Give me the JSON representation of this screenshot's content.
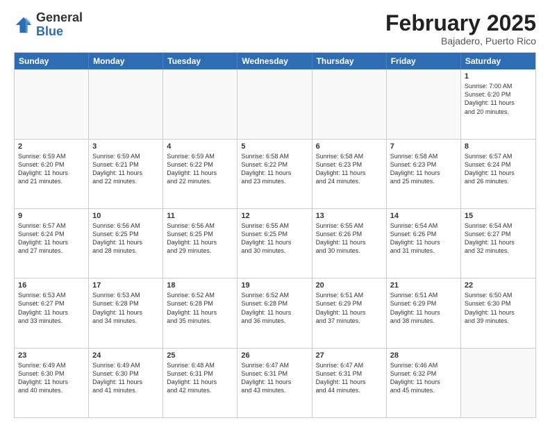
{
  "logo": {
    "general": "General",
    "blue": "Blue"
  },
  "header": {
    "month": "February 2025",
    "location": "Bajadero, Puerto Rico"
  },
  "days": [
    "Sunday",
    "Monday",
    "Tuesday",
    "Wednesday",
    "Thursday",
    "Friday",
    "Saturday"
  ],
  "weeks": [
    [
      {
        "day": "",
        "info": ""
      },
      {
        "day": "",
        "info": ""
      },
      {
        "day": "",
        "info": ""
      },
      {
        "day": "",
        "info": ""
      },
      {
        "day": "",
        "info": ""
      },
      {
        "day": "",
        "info": ""
      },
      {
        "day": "1",
        "info": "Sunrise: 7:00 AM\nSunset: 6:20 PM\nDaylight: 11 hours\nand 20 minutes."
      }
    ],
    [
      {
        "day": "2",
        "info": "Sunrise: 6:59 AM\nSunset: 6:20 PM\nDaylight: 11 hours\nand 21 minutes."
      },
      {
        "day": "3",
        "info": "Sunrise: 6:59 AM\nSunset: 6:21 PM\nDaylight: 11 hours\nand 22 minutes."
      },
      {
        "day": "4",
        "info": "Sunrise: 6:59 AM\nSunset: 6:22 PM\nDaylight: 11 hours\nand 22 minutes."
      },
      {
        "day": "5",
        "info": "Sunrise: 6:58 AM\nSunset: 6:22 PM\nDaylight: 11 hours\nand 23 minutes."
      },
      {
        "day": "6",
        "info": "Sunrise: 6:58 AM\nSunset: 6:23 PM\nDaylight: 11 hours\nand 24 minutes."
      },
      {
        "day": "7",
        "info": "Sunrise: 6:58 AM\nSunset: 6:23 PM\nDaylight: 11 hours\nand 25 minutes."
      },
      {
        "day": "8",
        "info": "Sunrise: 6:57 AM\nSunset: 6:24 PM\nDaylight: 11 hours\nand 26 minutes."
      }
    ],
    [
      {
        "day": "9",
        "info": "Sunrise: 6:57 AM\nSunset: 6:24 PM\nDaylight: 11 hours\nand 27 minutes."
      },
      {
        "day": "10",
        "info": "Sunrise: 6:56 AM\nSunset: 6:25 PM\nDaylight: 11 hours\nand 28 minutes."
      },
      {
        "day": "11",
        "info": "Sunrise: 6:56 AM\nSunset: 6:25 PM\nDaylight: 11 hours\nand 29 minutes."
      },
      {
        "day": "12",
        "info": "Sunrise: 6:55 AM\nSunset: 6:25 PM\nDaylight: 11 hours\nand 30 minutes."
      },
      {
        "day": "13",
        "info": "Sunrise: 6:55 AM\nSunset: 6:26 PM\nDaylight: 11 hours\nand 30 minutes."
      },
      {
        "day": "14",
        "info": "Sunrise: 6:54 AM\nSunset: 6:26 PM\nDaylight: 11 hours\nand 31 minutes."
      },
      {
        "day": "15",
        "info": "Sunrise: 6:54 AM\nSunset: 6:27 PM\nDaylight: 11 hours\nand 32 minutes."
      }
    ],
    [
      {
        "day": "16",
        "info": "Sunrise: 6:53 AM\nSunset: 6:27 PM\nDaylight: 11 hours\nand 33 minutes."
      },
      {
        "day": "17",
        "info": "Sunrise: 6:53 AM\nSunset: 6:28 PM\nDaylight: 11 hours\nand 34 minutes."
      },
      {
        "day": "18",
        "info": "Sunrise: 6:52 AM\nSunset: 6:28 PM\nDaylight: 11 hours\nand 35 minutes."
      },
      {
        "day": "19",
        "info": "Sunrise: 6:52 AM\nSunset: 6:28 PM\nDaylight: 11 hours\nand 36 minutes."
      },
      {
        "day": "20",
        "info": "Sunrise: 6:51 AM\nSunset: 6:29 PM\nDaylight: 11 hours\nand 37 minutes."
      },
      {
        "day": "21",
        "info": "Sunrise: 6:51 AM\nSunset: 6:29 PM\nDaylight: 11 hours\nand 38 minutes."
      },
      {
        "day": "22",
        "info": "Sunrise: 6:50 AM\nSunset: 6:30 PM\nDaylight: 11 hours\nand 39 minutes."
      }
    ],
    [
      {
        "day": "23",
        "info": "Sunrise: 6:49 AM\nSunset: 6:30 PM\nDaylight: 11 hours\nand 40 minutes."
      },
      {
        "day": "24",
        "info": "Sunrise: 6:49 AM\nSunset: 6:30 PM\nDaylight: 11 hours\nand 41 minutes."
      },
      {
        "day": "25",
        "info": "Sunrise: 6:48 AM\nSunset: 6:31 PM\nDaylight: 11 hours\nand 42 minutes."
      },
      {
        "day": "26",
        "info": "Sunrise: 6:47 AM\nSunset: 6:31 PM\nDaylight: 11 hours\nand 43 minutes."
      },
      {
        "day": "27",
        "info": "Sunrise: 6:47 AM\nSunset: 6:31 PM\nDaylight: 11 hours\nand 44 minutes."
      },
      {
        "day": "28",
        "info": "Sunrise: 6:46 AM\nSunset: 6:32 PM\nDaylight: 11 hours\nand 45 minutes."
      },
      {
        "day": "",
        "info": ""
      }
    ]
  ]
}
